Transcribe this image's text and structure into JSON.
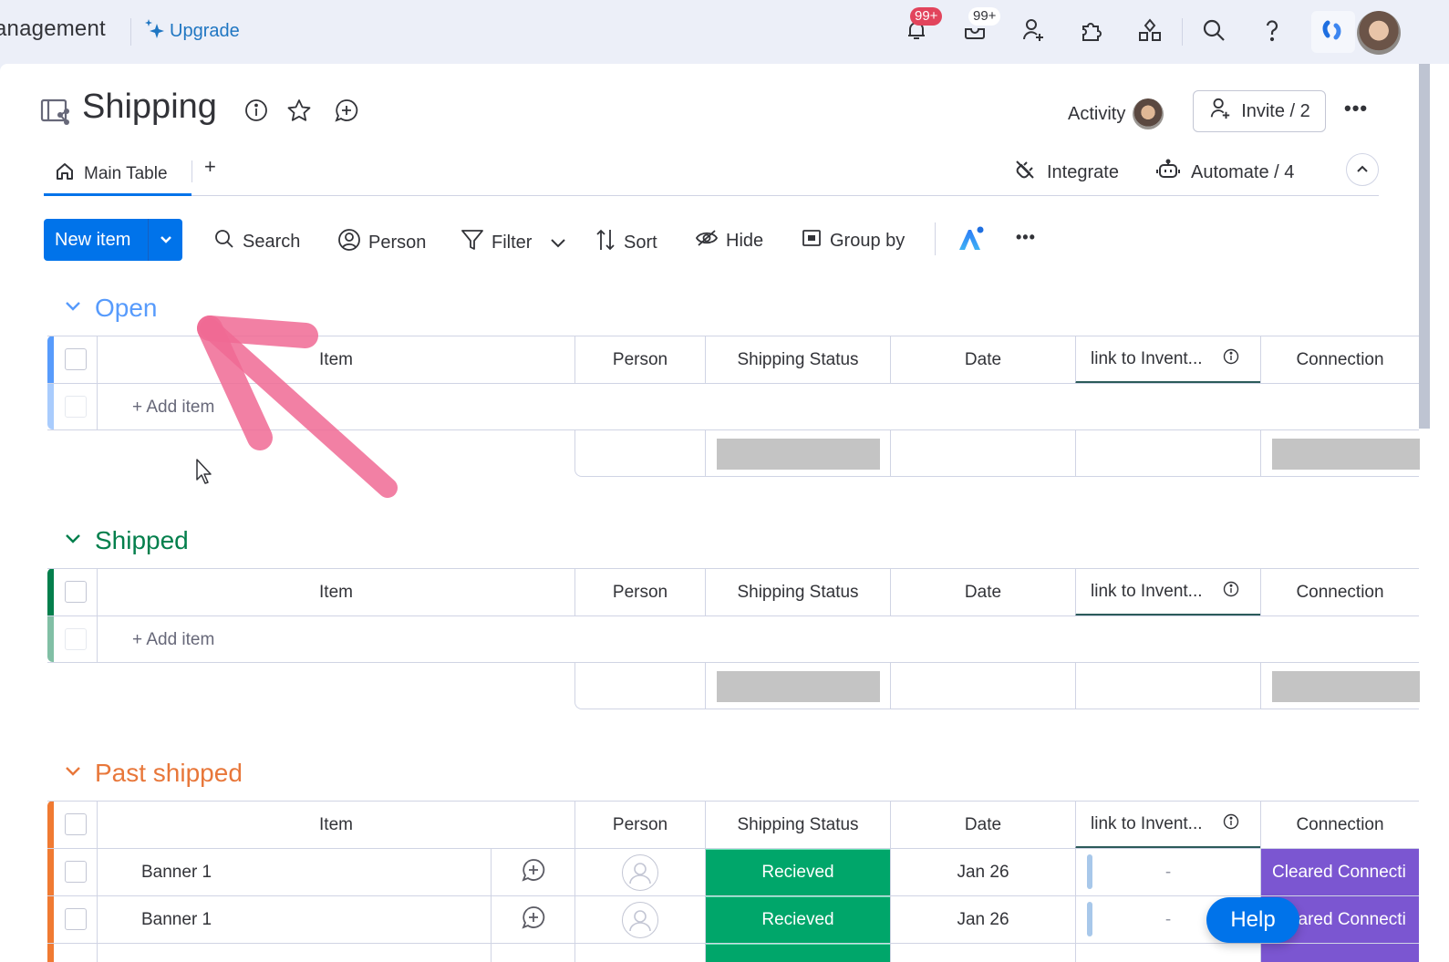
{
  "topbar": {
    "workspace_name": "anagement",
    "upgrade_label": "Upgrade",
    "notifications_badge": "99+",
    "inbox_badge": "99+",
    "icons": [
      "bell-icon",
      "inbox-icon",
      "invite-user-icon",
      "apps-puzzle-icon",
      "templates-icon",
      "search-icon",
      "help-icon",
      "product-switcher-icon",
      "user-avatar"
    ]
  },
  "board": {
    "title": "Shipping",
    "activity_label": "Activity",
    "invite_label": "Invite / 2",
    "tabs": [
      {
        "label": "Main Table",
        "active": true
      }
    ],
    "add_tab_label": "+",
    "integrate_label": "Integrate",
    "automate_label": "Automate / 4"
  },
  "toolbar": {
    "new_item_label": "New item",
    "search_label": "Search",
    "person_label": "Person",
    "filter_label": "Filter",
    "sort_label": "Sort",
    "hide_label": "Hide",
    "group_by_label": "Group by"
  },
  "columns": [
    "Item",
    "Person",
    "Shipping Status",
    "Date",
    "link to Invent...",
    "Connection"
  ],
  "groups": [
    {
      "title": "Open",
      "color": "#579bfc",
      "add_item_label": "+ Add item",
      "rows": []
    },
    {
      "title": "Shipped",
      "color": "#037f4c",
      "add_item_label": "+ Add item",
      "rows": []
    },
    {
      "title": "Past shipped",
      "color": "#e8773a",
      "rows": [
        {
          "item": "Banner 1",
          "status": "Recieved",
          "date": "Jan 26",
          "link": "-",
          "connection": "Cleared Connecti"
        },
        {
          "item": "Banner 1",
          "status": "Recieved",
          "date": "Jan 26",
          "link": "-",
          "connection": "Cleared Connecti"
        }
      ]
    }
  ],
  "colors": {
    "primary": "#0073ea",
    "status_received": "#00a66a",
    "connection": "#7b56d1"
  },
  "help_label": "Help"
}
